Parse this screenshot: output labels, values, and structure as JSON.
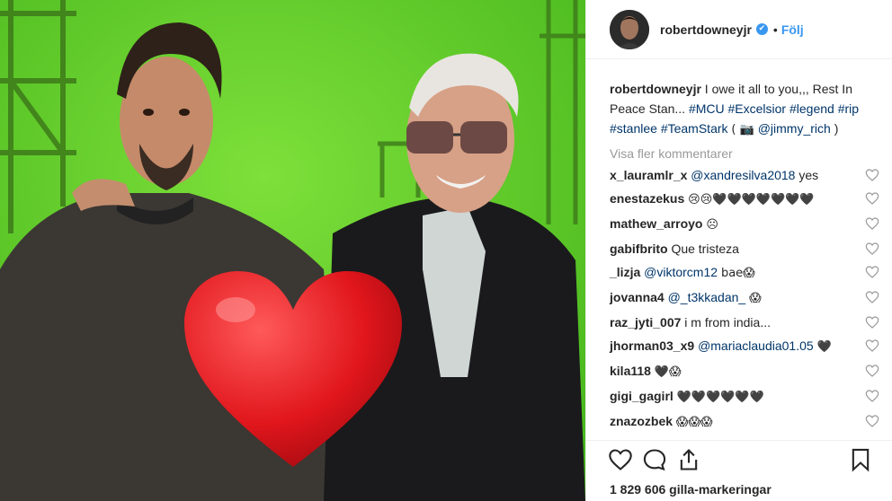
{
  "post": {
    "image_alt_icons": [
      "heart-emoji-icon"
    ],
    "author": "robertdowneyjr",
    "verified_badge": "✔",
    "dot": "•",
    "follow_label": "Följ"
  },
  "caption": {
    "user": "robertdowneyjr",
    "text": "I owe it all to you,,, Rest In Peace Stan...",
    "tags": [
      "#MCU",
      "#Excelsior",
      "#legend",
      "#rip",
      "#stanlee",
      "#TeamStark"
    ],
    "credit_open": "( 📷",
    "credit_user": "@jimmy_rich",
    "credit_close": ")"
  },
  "view_more": "Visa fler kommentarer",
  "comments": [
    {
      "user": "x_lauramlr_x",
      "mention": "@xandresilva2018",
      "text": "yes"
    },
    {
      "user": "enestazekus",
      "text": "😢😢🖤🖤🖤🖤🖤🖤🖤"
    },
    {
      "user": "mathew_arroyo",
      "text": "☹"
    },
    {
      "user": "gabifbrito",
      "text": "Que tristeza"
    },
    {
      "user": "_lizja",
      "mention": "@viktorcm12",
      "text": "bae😱"
    },
    {
      "user": "jovanna4",
      "mention": "@_t3kkadan_",
      "text": "😱"
    },
    {
      "user": "raz_jyti_007",
      "text": "i m from india..."
    },
    {
      "user": "jhorman03_x9",
      "mention": "@mariaclaudia01.05",
      "text": "🖤"
    },
    {
      "user": "kila118",
      "text": "🖤😱"
    },
    {
      "user": "gigi_gagirl",
      "text": "🖤🖤🖤🖤🖤🖤"
    },
    {
      "user": "znazozbek",
      "text": "😱😱😱"
    }
  ],
  "actions": {
    "like_icon": "heart-outline-icon",
    "comment_icon": "comment-icon",
    "share_icon": "share-icon",
    "save_icon": "bookmark-icon"
  },
  "likes_text": "1 829 606 gilla-markeringar",
  "colors": {
    "link": "#003569",
    "follow": "#3897f0",
    "greenscreen": "#5fd02a",
    "heart": "#e0161c"
  }
}
